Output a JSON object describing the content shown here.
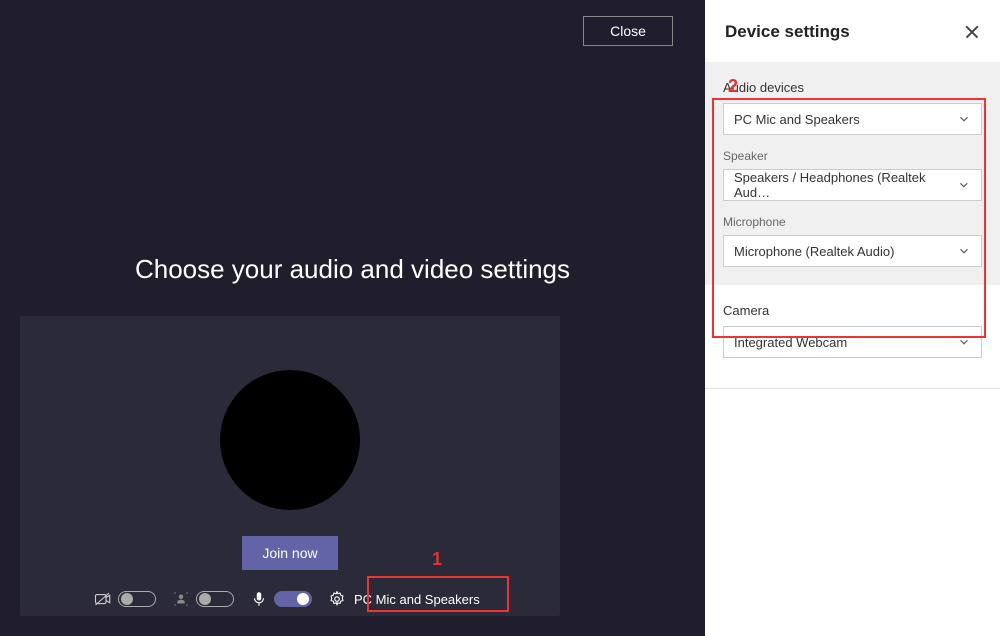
{
  "main": {
    "close_label": "Close",
    "heading": "Choose your audio and video settings",
    "join_label": "Join now",
    "device_current": "PC Mic and Speakers"
  },
  "annotations": {
    "one": "1",
    "two": "2"
  },
  "settings": {
    "title": "Device settings",
    "audio": {
      "section_label": "Audio devices",
      "device_value": "PC Mic and Speakers",
      "speaker_label": "Speaker",
      "speaker_value": "Speakers / Headphones (Realtek Aud…",
      "microphone_label": "Microphone",
      "microphone_value": "Microphone (Realtek Audio)"
    },
    "camera": {
      "section_label": "Camera",
      "value": "Integrated Webcam"
    }
  },
  "icons": {
    "camera_off": "camera-off-icon",
    "blur": "blur-icon",
    "mic": "mic-icon",
    "gear": "gear-icon",
    "chevron": "chevron-down-icon",
    "close": "close-icon"
  }
}
